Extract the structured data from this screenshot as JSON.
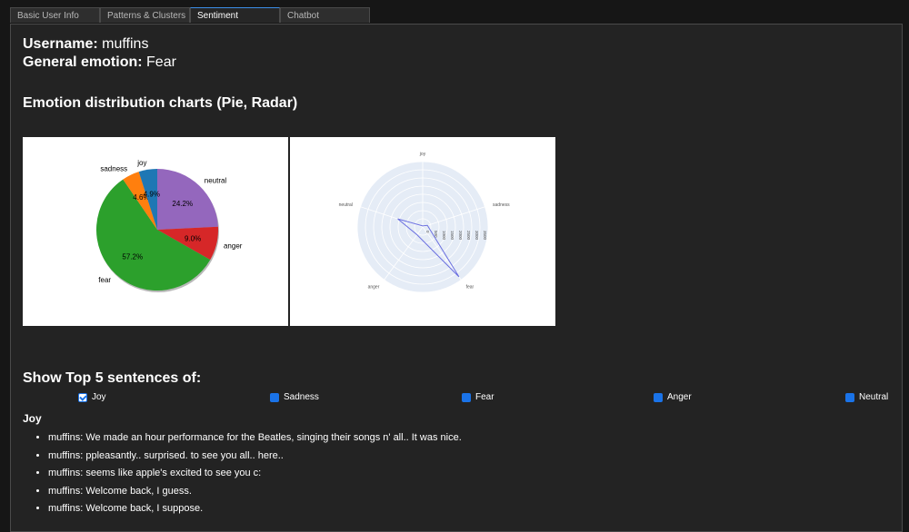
{
  "tabs": [
    {
      "label": "Basic User Info",
      "active": false
    },
    {
      "label": "Patterns & Clusters",
      "active": false
    },
    {
      "label": "Sentiment",
      "active": true
    },
    {
      "label": "Chatbot",
      "active": false
    }
  ],
  "user": {
    "username_label": "Username:",
    "username": "muffins",
    "emotion_label": "General emotion:",
    "emotion": "Fear"
  },
  "charts_title": "Emotion distribution charts (Pie, Radar)",
  "chart_data": [
    {
      "type": "pie",
      "categories": [
        "neutral",
        "anger",
        "fear",
        "sadness",
        "joy"
      ],
      "values": [
        24.2,
        9.0,
        57.2,
        4.6,
        4.9
      ],
      "value_labels": [
        "24.2%",
        "9.0%",
        "57.2%",
        "4.6%",
        "4.9%"
      ],
      "colors": [
        "#9467bd",
        "#d62728",
        "#2ca02c",
        "#ff7f0e",
        "#1f77b4"
      ]
    },
    {
      "type": "radar",
      "axes": [
        "joy",
        "sadness",
        "fear",
        "anger",
        "neutral"
      ],
      "values": [
        60,
        290,
        3580,
        560,
        1520
      ],
      "radial_ticks": [
        "0",
        "500",
        "1000",
        "1500",
        "2000",
        "2500",
        "3000",
        "3500"
      ],
      "radial_max": 3800,
      "line_color": "#6a6fe0",
      "background": "#e5ecf6"
    }
  ],
  "filter": {
    "title": "Show Top 5 sentences of:",
    "options": [
      {
        "label": "Joy",
        "checked": true
      },
      {
        "label": "Sadness",
        "checked": false
      },
      {
        "label": "Fear",
        "checked": false
      },
      {
        "label": "Anger",
        "checked": false
      },
      {
        "label": "Neutral",
        "checked": false
      }
    ]
  },
  "sentences": {
    "heading": "Joy",
    "items": [
      "muffins: We made an hour performance for the Beatles, singing their songs n' all.. It was nice.",
      "muffins: ppleasantly.. surprised. to see you all.. here..",
      "muffins: seems like apple's excited to see you c:",
      "muffins: Welcome back, I guess.",
      "muffins: Welcome back, I suppose."
    ]
  }
}
